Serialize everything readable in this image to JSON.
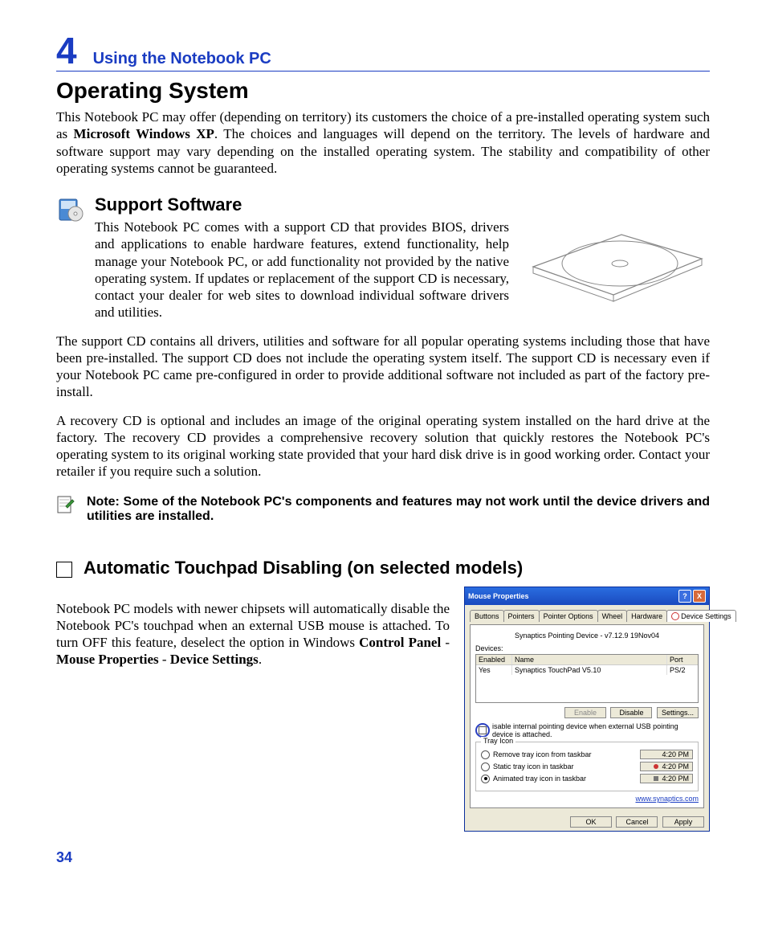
{
  "chapter": {
    "number": "4",
    "title": "Using the Notebook PC"
  },
  "h1": "Operating System",
  "p1": "This Notebook PC may offer (depending on territory) its customers the choice of a pre-installed operating system such as ",
  "p1b": "Microsoft Windows XP",
  "p1c": ". The choices and languages will depend on the territory. The levels of hardware and software support may vary depending on the installed operating system. The stability and compatibility of other operating systems cannot be guaranteed.",
  "h2a": "Support Software",
  "p2": "This Notebook PC comes with a support CD that provides BIOS, drivers and applications to enable hardware features, extend functionality, help manage your Notebook PC, or add functionality not provided by the native operating system. If updates or replacement of the support CD is necessary, contact your dealer for web sites to download individual software drivers and utilities.",
  "p3": "The support CD contains all drivers, utilities and software for all popular operating systems including those that have been pre-installed. The support CD does not include the operating system itself. The support CD is necessary even if your Notebook PC came pre-configured in order to provide additional software not included as part of the factory pre-install.",
  "p4": "A recovery CD is optional and includes an image of the original operating system installed on the hard drive at the factory. The recovery CD provides a comprehensive recovery solution that quickly restores the Notebook PC's operating system to its original working state provided that your hard disk drive is in good working order. Contact your retailer if you require such a solution.",
  "note": "Note: Some of the Notebook PC's components and features may not work until the device drivers and utilities are installed.",
  "h2b": "Automatic Touchpad Disabling (on selected models)",
  "p5a": "Notebook PC models with newer chipsets will automatically disable the Notebook PC's touchpad when an external USB mouse is attached. To turn OFF this feature, deselect the option in Windows ",
  "p5b": "Control Panel",
  "p5c": " - ",
  "p5d": "Mouse Properties",
  "p5e": " - ",
  "p5f": "Device Settings",
  "p5g": ".",
  "dialog": {
    "title": "Mouse Properties",
    "tabs": [
      "Buttons",
      "Pointers",
      "Pointer Options",
      "Wheel",
      "Hardware",
      "Device Settings"
    ],
    "active_tab": "Device Settings",
    "subtitle": "Synaptics Pointing Device - v7.12.9 19Nov04",
    "devices_label": "Devices:",
    "col1": "Enabled",
    "col2": "Name",
    "col3": "Port",
    "row1": {
      "enabled": "Yes",
      "name": "Synaptics TouchPad V5.10",
      "port": "PS/2"
    },
    "btn_enable": "Enable",
    "btn_disable": "Disable",
    "btn_settings": "Settings...",
    "checkbox": "isable internal pointing device when external USB pointing device is attached.",
    "tray_legend": "Tray Icon",
    "tray1": "Remove tray icon from taskbar",
    "tray2": "Static tray icon in taskbar",
    "tray3": "Animated tray icon in taskbar",
    "time": "4:20 PM",
    "link": "www.synaptics.com",
    "ok": "OK",
    "cancel": "Cancel",
    "apply": "Apply"
  },
  "pagenum": "34"
}
